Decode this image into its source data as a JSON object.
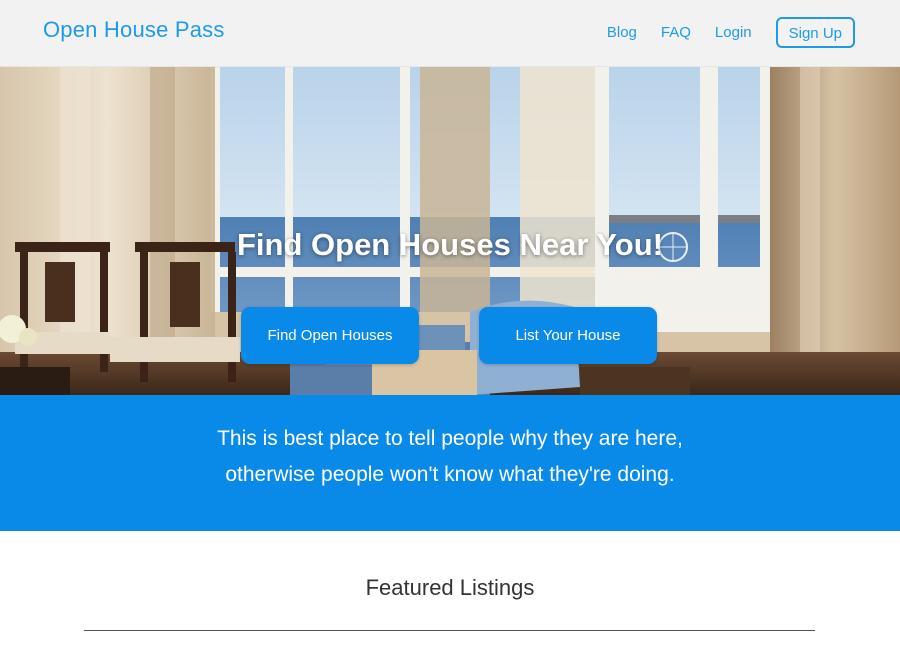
{
  "header": {
    "brand": "Open House Pass",
    "nav": [
      "Blog",
      "FAQ",
      "Login"
    ],
    "signup_label": "Sign Up"
  },
  "hero": {
    "title": "Find Open Houses Near You!",
    "buttons": [
      "Find Open Houses",
      "List Your House"
    ]
  },
  "banner": {
    "line1": "This is best place to tell people why they are here,",
    "line2": "otherwise people won't know what they're doing."
  },
  "featured": {
    "title": "Featured Listings"
  },
  "colors": {
    "accent": "#1e9be8",
    "primary_blue": "#0a8ae8",
    "nav_bg": "#f2f2f2"
  }
}
